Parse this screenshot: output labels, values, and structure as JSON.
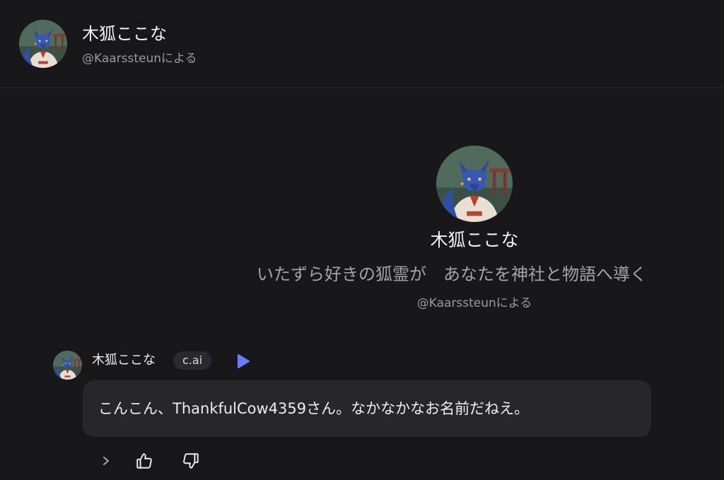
{
  "header": {
    "character_name": "木狐ここな",
    "creator_byline": "@Kaarssteunによる"
  },
  "profile": {
    "name": "木狐ここな",
    "tagline": "いたずら好きの狐霊が　あなたを神社と物語へ導く",
    "creator_byline": "@Kaarssteunによる"
  },
  "message": {
    "sender": "木狐ここな",
    "badge": "c.ai",
    "text": "こんこん、ThankfulCow4359さん。なかなかなお名前だねえ。"
  },
  "icons": {
    "avatar": "fox-spirit-portrait",
    "play": "play-icon",
    "chevron": "chevron-right-icon",
    "like": "thumbs-up-icon",
    "dislike": "thumbs-down-icon"
  },
  "colors": {
    "background": "#18181b",
    "bubble": "#27272a",
    "play_accent": "#6b7cff",
    "muted_text": "#9a9a9f"
  }
}
